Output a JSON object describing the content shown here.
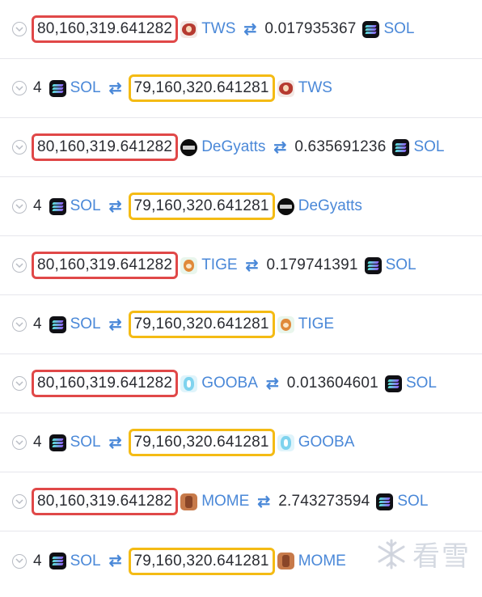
{
  "rows": [
    {
      "type": "sell",
      "amount": "80,160,319.641282",
      "token": "TWS",
      "token_icon": "tws-icon",
      "other_amount": "0.017935367",
      "other_token": "SOL",
      "other_icon": "sol-icon"
    },
    {
      "type": "buy",
      "count": "4",
      "token": "SOL",
      "token_icon": "sol-icon",
      "amount": "79,160,320.641281",
      "other_token": "TWS",
      "other_icon": "tws-icon"
    },
    {
      "type": "sell",
      "amount": "80,160,319.641282",
      "token": "DeGyatts",
      "token_icon": "degyatts-icon",
      "other_amount": "0.635691236",
      "other_token": "SOL",
      "other_icon": "sol-icon"
    },
    {
      "type": "buy",
      "count": "4",
      "token": "SOL",
      "token_icon": "sol-icon",
      "amount": "79,160,320.641281",
      "other_token": "DeGyatts",
      "other_icon": "degyatts-icon"
    },
    {
      "type": "sell",
      "amount": "80,160,319.641282",
      "token": "TIGE",
      "token_icon": "tige-icon",
      "other_amount": "0.179741391",
      "other_token": "SOL",
      "other_icon": "sol-icon"
    },
    {
      "type": "buy",
      "count": "4",
      "token": "SOL",
      "token_icon": "sol-icon",
      "amount": "79,160,320.641281",
      "other_token": "TIGE",
      "other_icon": "tige-icon"
    },
    {
      "type": "sell",
      "amount": "80,160,319.641282",
      "token": "GOOBA",
      "token_icon": "gooba-icon",
      "other_amount": "0.013604601",
      "other_token": "SOL",
      "other_icon": "sol-icon"
    },
    {
      "type": "buy",
      "count": "4",
      "token": "SOL",
      "token_icon": "sol-icon",
      "amount": "79,160,320.641281",
      "other_token": "GOOBA",
      "other_icon": "gooba-icon"
    },
    {
      "type": "sell",
      "amount": "80,160,319.641282",
      "token": "MOME",
      "token_icon": "mome-icon",
      "other_amount": "2.743273594",
      "other_token": "SOL",
      "other_icon": "sol-icon"
    },
    {
      "type": "buy",
      "count": "4",
      "token": "SOL",
      "token_icon": "sol-icon",
      "amount": "79,160,320.641281",
      "other_token": "MOME",
      "other_icon": "mome-icon"
    }
  ],
  "swap_symbol": "⇄",
  "watermark": "看雪",
  "colors": {
    "highlight_red": "#e04848",
    "highlight_yellow": "#f4bb14",
    "link_blue": "#4a88d8"
  }
}
